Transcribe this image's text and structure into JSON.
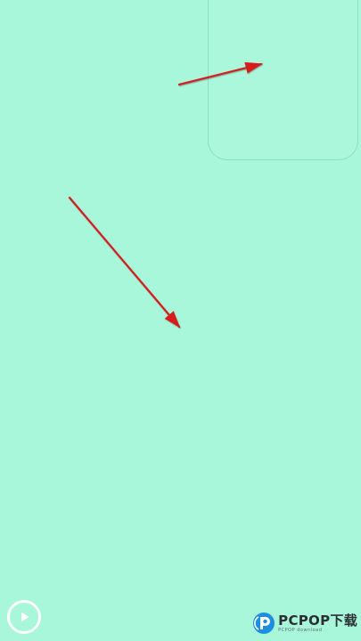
{
  "screen": {
    "background_color": "#a8f7db",
    "arrow_color": "#d61f1f"
  },
  "controls": {
    "play_icon": "play-icon"
  },
  "watermark": {
    "brand": "PCPOP下载",
    "subtitle": "PCPOP download"
  }
}
